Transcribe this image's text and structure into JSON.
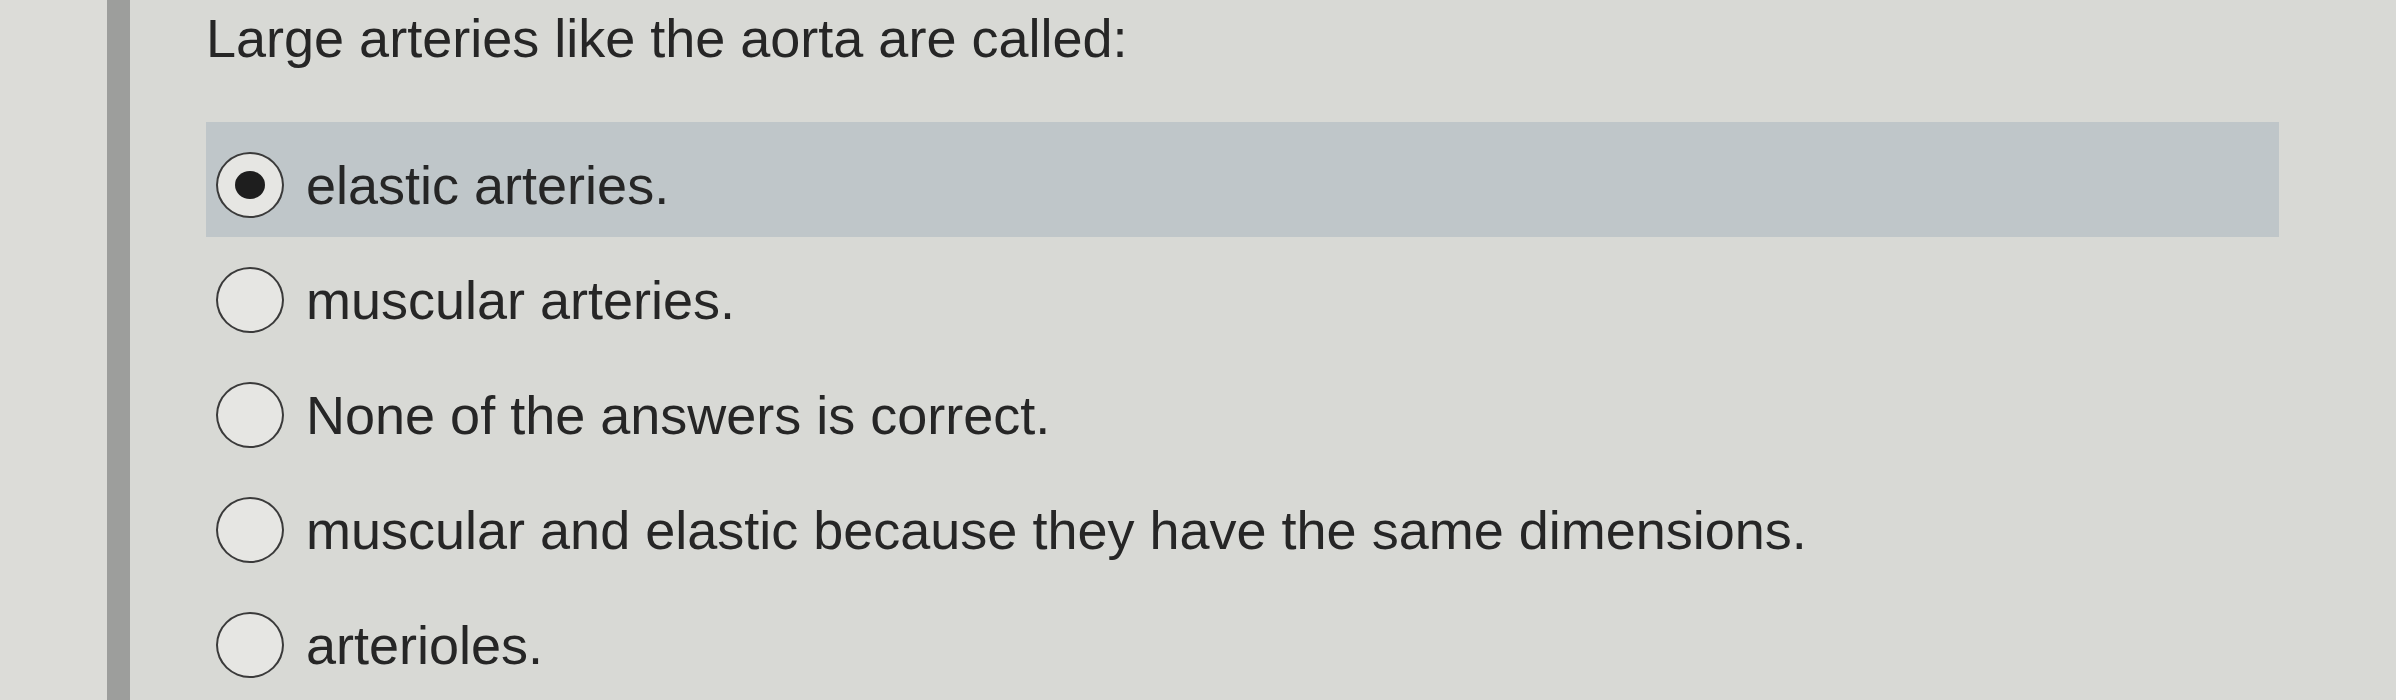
{
  "question": "Large arteries like the aorta are called:",
  "options": [
    {
      "label": "elastic arteries.",
      "selected": true
    },
    {
      "label": "muscular arteries.",
      "selected": false
    },
    {
      "label": "None of the answers is correct.",
      "selected": false
    },
    {
      "label": "muscular and elastic because they have the same dimensions.",
      "selected": false
    },
    {
      "label": "arterioles.",
      "selected": false
    }
  ]
}
